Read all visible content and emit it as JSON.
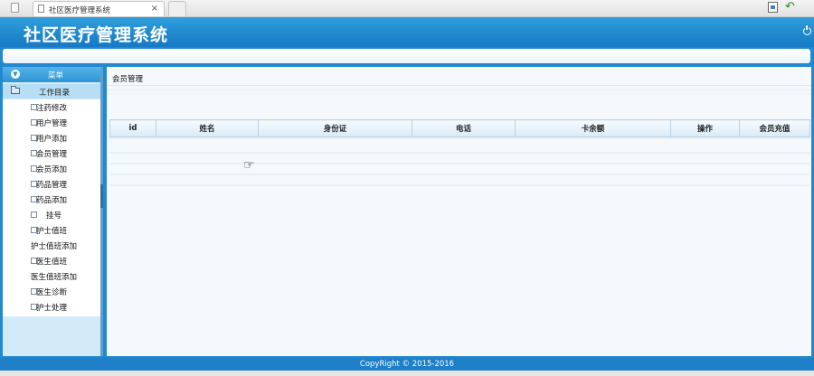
{
  "browser": {
    "tab_title": "社区医疗管理系统",
    "tab_close": "×"
  },
  "app": {
    "title": "社区医疗管理系统"
  },
  "sidebar": {
    "menu_header": "菜单",
    "section_label": "工作目录",
    "items": [
      {
        "label": "注药修改"
      },
      {
        "label": "用户管理"
      },
      {
        "label": "用户添加"
      },
      {
        "label": "会员管理"
      },
      {
        "label": "会员添加"
      },
      {
        "label": "药品管理"
      },
      {
        "label": "药品添加"
      },
      {
        "label": "挂号"
      },
      {
        "label": "护士值班"
      },
      {
        "label": "护士值班添加"
      },
      {
        "label": "医生值班"
      },
      {
        "label": "医生值班添加"
      },
      {
        "label": "医生诊断"
      },
      {
        "label": "护士处理"
      }
    ]
  },
  "main": {
    "breadcrumb": "会员管理",
    "table": {
      "columns": [
        "id",
        "姓名",
        "身份证",
        "电话",
        "卡余额",
        "操作",
        "会员充值"
      ]
    }
  },
  "footer": {
    "copyright": "CopyRight © 2015-2016"
  },
  "colors": {
    "header_blue": "#1f86cf",
    "sidebar_bg": "#d3ebf8",
    "content_bg": "#f6f9fc"
  },
  "icons": [
    "page-icon",
    "home-icon",
    "back-arrow-icon",
    "power-icon",
    "chevron-down-icon",
    "folder-icon",
    "document-icon",
    "hand-cursor-icon"
  ]
}
